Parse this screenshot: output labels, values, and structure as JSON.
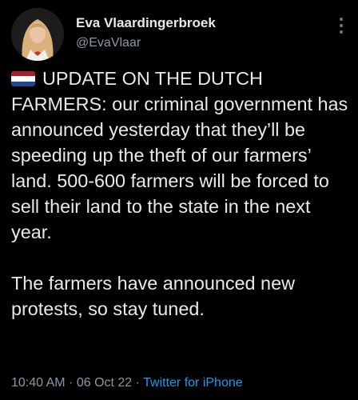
{
  "author": {
    "display_name": "Eva Vlaardingerbroek",
    "handle": "@EvaVlaar"
  },
  "tweet": {
    "flag_icon": "netherlands-flag-icon",
    "flag_colors": [
      "#ae1c28",
      "#ffffff",
      "#21468b"
    ],
    "paragraph_1": "UPDATE ON THE DUTCH FARMERS: our criminal government has announced yesterday that they’ll be speeding up the theft of our farmers’ land. 500-600 farmers will be forced to sell their land to the state in the next year.",
    "paragraph_2": "The farmers have announced new protests, so stay tuned."
  },
  "meta": {
    "time": "10:40 AM",
    "separator_1": " · ",
    "date": "06 Oct 22",
    "separator_2": " · ",
    "source": "Twitter for iPhone"
  },
  "colors": {
    "background": "#000000",
    "text": "#e7e9ea",
    "secondary": "#8b98a5",
    "link": "#1d9bf0"
  }
}
